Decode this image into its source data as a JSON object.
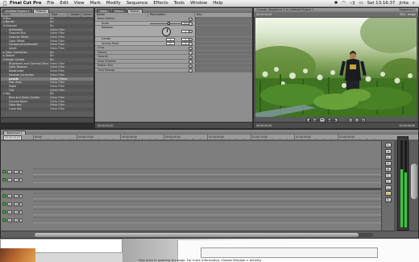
{
  "menubar": {
    "apple": "",
    "app_name": "Final Cut Pro",
    "items": [
      "File",
      "Edit",
      "View",
      "Mark",
      "Modify",
      "Sequence",
      "Effects",
      "Tools",
      "Window",
      "Help"
    ],
    "clock": "Sat 13:16:37",
    "user": "jirka"
  },
  "browser": {
    "tabs": [
      "Untitled Project 1",
      "Effects"
    ],
    "columns": [
      "Name",
      "Type",
      "Length",
      "Comm"
    ],
    "rows": [
      {
        "name": "Blur",
        "type": "Bin",
        "indent": 1,
        "open": true
      },
      {
        "name": "Border",
        "type": "Bin",
        "indent": 1,
        "open": false
      },
      {
        "name": "Channel",
        "type": "Bin",
        "indent": 1,
        "open": true
      },
      {
        "name": "Arithmetic",
        "type": "Video Filter",
        "indent": 2
      },
      {
        "name": "Channel Blur",
        "type": "Video Filter",
        "indent": 2
      },
      {
        "name": "Channel Offset",
        "type": "Video Filter",
        "indent": 2
      },
      {
        "name": "Color Offset",
        "type": "Video Filter",
        "indent": 2
      },
      {
        "name": "Compound Arithmetic",
        "type": "Video Filter",
        "indent": 2
      },
      {
        "name": "Invert",
        "type": "Video Filter",
        "indent": 2
      },
      {
        "name": "Color Correction",
        "type": "Bin",
        "indent": 1,
        "open": false
      },
      {
        "name": "Distort",
        "type": "Bin",
        "indent": 1,
        "open": false
      },
      {
        "name": "Image Control",
        "type": "Bin",
        "indent": 1,
        "open": true
      },
      {
        "name": "Brightness and Contrast (Bez)",
        "type": "Video Filter",
        "indent": 2
      },
      {
        "name": "Color Balance",
        "type": "Video Filter",
        "indent": 2
      },
      {
        "name": "Desaturate",
        "type": "Video Filter",
        "indent": 2
      },
      {
        "name": "Gamma Correction",
        "type": "Video Filter",
        "indent": 2
      },
      {
        "name": "Levels",
        "type": "Video Filter",
        "indent": 2,
        "selected": true
      },
      {
        "name": "Proc Amp",
        "type": "Video Filter",
        "indent": 2
      },
      {
        "name": "Sepia",
        "type": "Video Filter",
        "indent": 2
      },
      {
        "name": "Tint",
        "type": "Video Filter",
        "indent": 2
      },
      {
        "name": "Key",
        "type": "Bin",
        "indent": 1,
        "open": false
      },
      {
        "name": "Blue and Green Screen",
        "type": "Video Filter",
        "indent": 2
      },
      {
        "name": "Chroma Keyer",
        "type": "Video Filter",
        "indent": 2
      },
      {
        "name": "Color Key",
        "type": "Video Filter",
        "indent": 2
      },
      {
        "name": "Luma Key",
        "type": "Video Filter",
        "indent": 2
      }
    ]
  },
  "viewer": {
    "tabs": [
      "Video",
      "Filters",
      "Motion"
    ],
    "columns": [
      "Name",
      "Parameters",
      "Nav"
    ],
    "basic_motion": "Basic Motion",
    "params": [
      {
        "label": "Scale",
        "value": "100",
        "thumb_fraction": 0.55
      },
      {
        "label": "Rotation",
        "value": "0",
        "dial": true
      },
      {
        "label": "Center",
        "value": "0",
        "second": "0"
      },
      {
        "label": "Anchor Point",
        "value": "0",
        "second": "0"
      }
    ],
    "sections": [
      "Crop",
      "Distort",
      "Opacity",
      "Drop Shadow",
      "Motion Blur",
      "Time Remap"
    ],
    "timecode": "00:00:00;00"
  },
  "canvas": {
    "title": "Canvas: Sequence 1 in Untitled Project 1",
    "tab": "Sequence 1",
    "bar_left": "00:00:00;00",
    "zoom": "50%",
    "view": "Image",
    "timecode_left": "00:00:00;00",
    "timecode_right": "00:00:00;00",
    "transport": [
      "|◀",
      "◀◀",
      "▶",
      "▶▶",
      "▶|"
    ],
    "transport_right": [
      "⊞",
      "⊡",
      "◉"
    ]
  },
  "timeline": {
    "tab": "Sequence 1",
    "current_timecode": "00:00:00;00",
    "ruler_labels": [
      "00:00",
      "00:00:15;00",
      "00:00:30;00",
      "00:00:45;00",
      "01:00:00;00",
      "01:00:15;00",
      "01:00:30;00",
      "01:00:45;00"
    ],
    "video_tracks": [
      "V2",
      "V1"
    ],
    "audio_tracks": [
      "A1",
      "A2",
      "A3",
      "A4"
    ],
    "tools": [
      "↖",
      "⇥",
      "◇",
      "✂",
      "⊕",
      "⌇",
      "▢",
      "🔍",
      "✋",
      "✎"
    ]
  },
  "desktop": {
    "status": "One error in opening the page. For more information, choose Window > Activity."
  }
}
